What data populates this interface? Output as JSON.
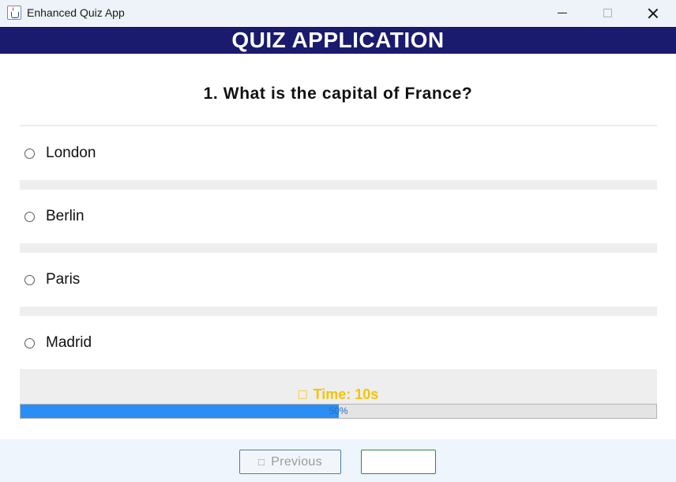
{
  "window": {
    "title": "Enhanced Quiz App"
  },
  "header": {
    "title": "QUIZ APPLICATION"
  },
  "question": {
    "text": "1. What is the capital of France?"
  },
  "options": [
    {
      "label": "London",
      "selected": false
    },
    {
      "label": "Berlin",
      "selected": false
    },
    {
      "label": "Paris",
      "selected": false
    },
    {
      "label": "Madrid",
      "selected": false
    }
  ],
  "timer": {
    "icon": "stopwatch-icon",
    "text": "Time: 10s",
    "progress_percent": 50,
    "progress_label": "50%"
  },
  "footer": {
    "previous_label": "Previous",
    "previous_icon": "arrow-left-icon",
    "next_label": ""
  },
  "colors": {
    "header_bg": "#1a1a6e",
    "timer_text": "#f6c400",
    "progress_fill": "#2b8ef5",
    "next_border": "#2e8b3a",
    "previous_border": "#4a7fb0"
  }
}
